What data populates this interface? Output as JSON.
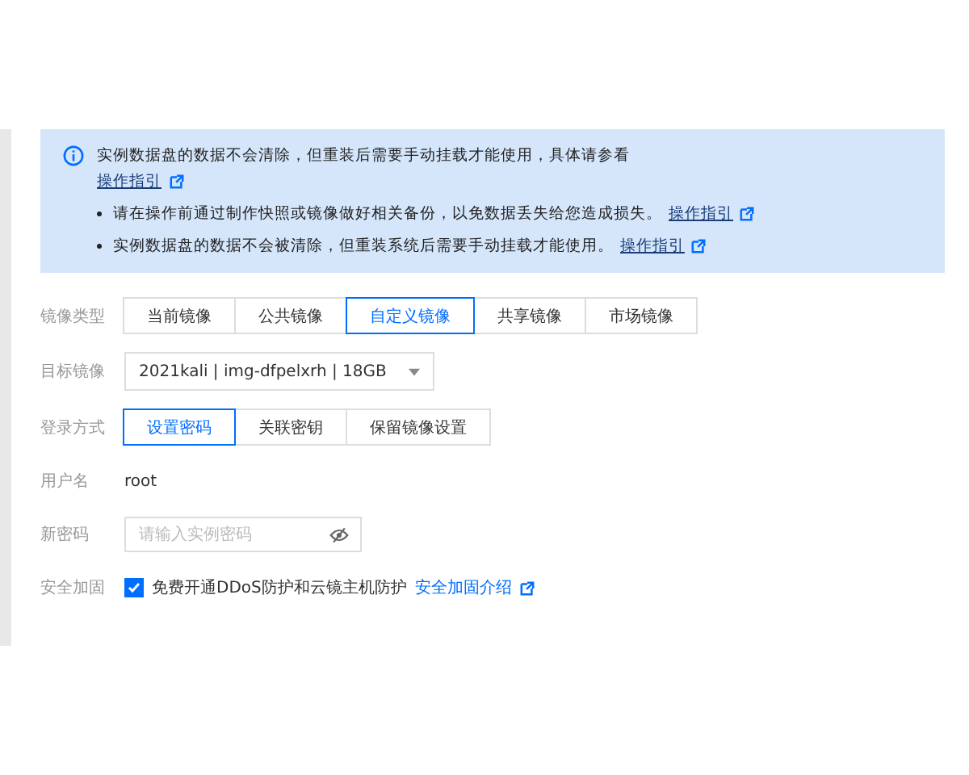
{
  "notice": {
    "headline": "实例数据盘的数据不会清除，但重装后需要手动挂载才能使用，具体请参看",
    "headline_link": "操作指引",
    "bullets": [
      {
        "text": "请在操作前通过制作快照或镜像做好相关备份，以免数据丢失给您造成损失。",
        "link": "操作指引"
      },
      {
        "text": "实例数据盘的数据不会被清除，但重装系统后需要手动挂载才能使用。",
        "link": "操作指引"
      }
    ]
  },
  "image_type": {
    "label": "镜像类型",
    "options": [
      {
        "label": "当前镜像",
        "selected": false
      },
      {
        "label": "公共镜像",
        "selected": false
      },
      {
        "label": "自定义镜像",
        "selected": true
      },
      {
        "label": "共享镜像",
        "selected": false
      },
      {
        "label": "市场镜像",
        "selected": false
      }
    ]
  },
  "target_image": {
    "label": "目标镜像",
    "value": "2021kali | img-dfpelxrh | 18GB"
  },
  "login_method": {
    "label": "登录方式",
    "options": [
      {
        "label": "设置密码",
        "selected": true
      },
      {
        "label": "关联密钥",
        "selected": false
      },
      {
        "label": "保留镜像设置",
        "selected": false
      }
    ]
  },
  "username": {
    "label": "用户名",
    "value": "root"
  },
  "new_password": {
    "label": "新密码",
    "placeholder": "请输入实例密码"
  },
  "security": {
    "label": "安全加固",
    "checked": true,
    "text": "免费开通DDoS防护和云镜主机防护",
    "link": "安全加固介绍"
  }
}
